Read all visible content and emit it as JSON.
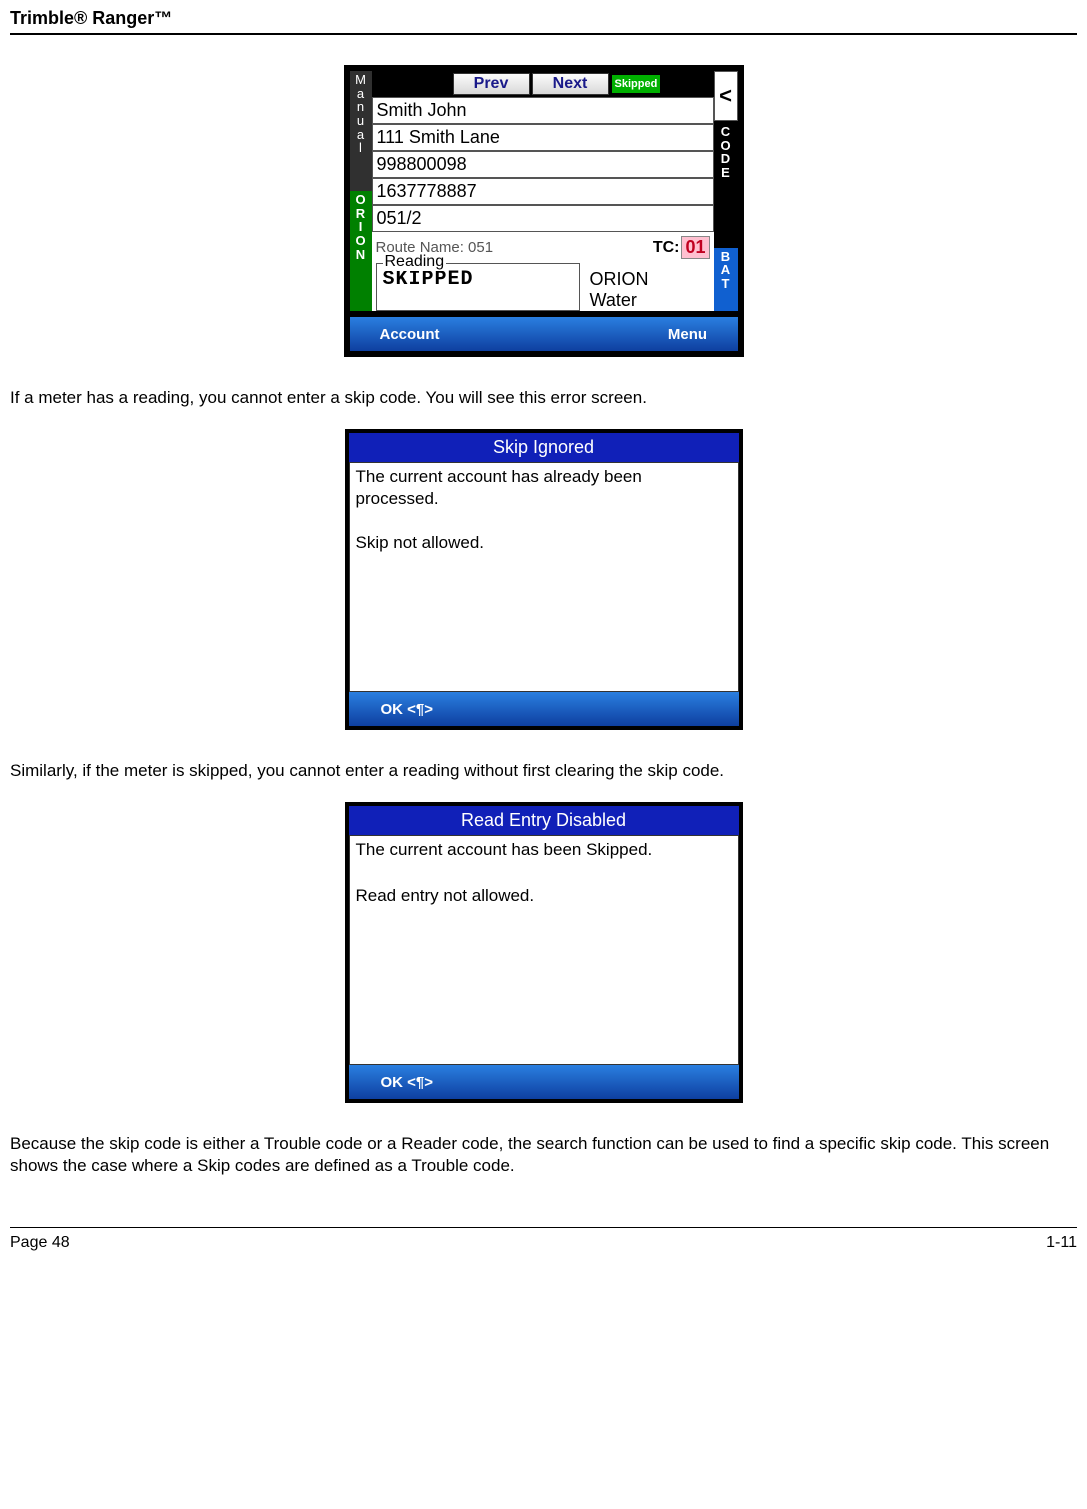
{
  "header": {
    "title": "Trimble® Ranger™"
  },
  "screenshot1": {
    "nav": {
      "prev": "Prev",
      "next": "Next",
      "skipped": "Skipped"
    },
    "sideLeft": {
      "manual": "Manual",
      "orion": "ORION"
    },
    "sideRight": {
      "lt": "<",
      "code": "CODE",
      "bat": "BAT"
    },
    "fields": {
      "name": "Smith John",
      "addr": "111 Smith Lane",
      "num1": "998800098",
      "num2": "1637778887",
      "num3": "051/2"
    },
    "route": {
      "label": "Route Name: 051",
      "tcLabel": "TC:",
      "tcVal": "01"
    },
    "reading": {
      "legend": "Reading",
      "value": "SKIPPED"
    },
    "orionWater": {
      "l1": "ORION",
      "l2": "Water"
    },
    "softbar": {
      "left": "Account",
      "right": "Menu"
    }
  },
  "para1": "If a meter has a reading, you cannot enter a skip code.  You will see this error screen.",
  "dialog1": {
    "title": "Skip Ignored",
    "line1": "The current account has already been",
    "line2": "processed.",
    "line3": "Skip not allowed.",
    "ok": "OK <¶>"
  },
  "para2": "Similarly, if the meter is skipped, you cannot enter a reading without first clearing the skip code.",
  "dialog2": {
    "title": "Read Entry Disabled",
    "line1": "The current account has been Skipped.",
    "line3": "Read entry not allowed.",
    "ok": "OK <¶>"
  },
  "para3": "Because the skip code is either a Trouble code or a Reader code, the search function can be used to find a specific skip code.  This screen shows the case where a Skip codes are defined as a Trouble code.",
  "footer": {
    "left": "Page 48",
    "right": "1-11"
  }
}
